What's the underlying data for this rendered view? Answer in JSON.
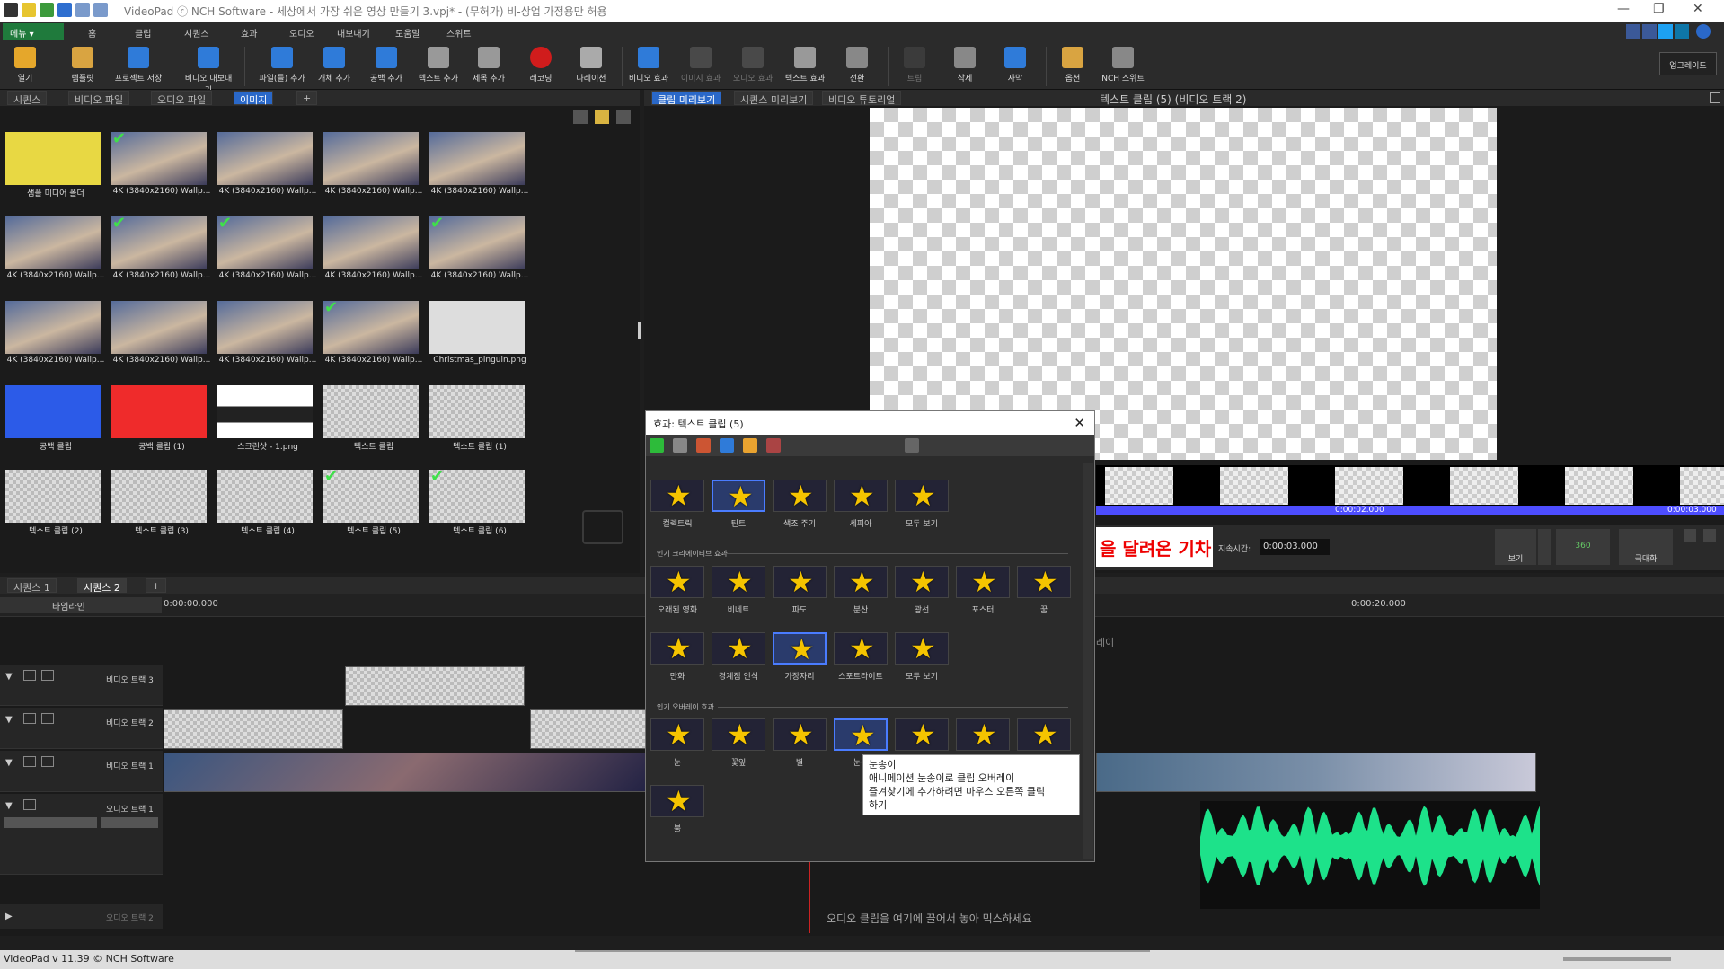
{
  "titlebar": {
    "title": "VideoPad ⓒ NCH Software - 세상에서 가장 쉬운 영상 만들기 3.vpj* - (무허가) 비-상업 가정용만 허용"
  },
  "menu": {
    "menu_button": "메뉴 ▾",
    "items": [
      "홈",
      "클립",
      "시퀀스",
      "효과",
      "오디오",
      "내보내기",
      "도움말",
      "스위트"
    ]
  },
  "toolbar": {
    "buttons": [
      "열기",
      "템플릿",
      "프로젝트 저장",
      "비디오 내보내기",
      "파일(들) 추가",
      "개체 추가",
      "공백 추가",
      "텍스트 추가",
      "제목 추가",
      "레코딩",
      "나레이션",
      "비디오 효과",
      "이미지 효과",
      "오디오 효과",
      "텍스트 효과",
      "전환",
      "트림",
      "삭제",
      "자막",
      "옵션",
      "NCH 스위트"
    ],
    "upgrade": "업그레이드"
  },
  "media_tabs": [
    "시퀀스",
    "비디오 파일",
    "오디오 파일",
    "이미지"
  ],
  "media_items": [
    {
      "label": "샘플 미디어 폴더",
      "check": false,
      "kind": "folder"
    },
    {
      "label": "4K (3840x2160) Wallp...",
      "check": true,
      "kind": "photo"
    },
    {
      "label": "4K (3840x2160) Wallp...",
      "check": false,
      "kind": "photo"
    },
    {
      "label": "4K (3840x2160) Wallp...",
      "check": false,
      "kind": "photo"
    },
    {
      "label": "4K (3840x2160) Wallp...",
      "check": false,
      "kind": "photo"
    },
    {
      "label": "4K (3840x2160) Wallp...",
      "check": false,
      "kind": "photo"
    },
    {
      "label": "4K (3840x2160) Wallp...",
      "check": true,
      "kind": "photo"
    },
    {
      "label": "4K (3840x2160) Wallp...",
      "check": true,
      "kind": "photo"
    },
    {
      "label": "4K (3840x2160) Wallp...",
      "check": false,
      "kind": "photo"
    },
    {
      "label": "4K (3840x2160) Wallp...",
      "check": true,
      "kind": "photo"
    },
    {
      "label": "4K (3840x2160) Wallp...",
      "check": false,
      "kind": "photo"
    },
    {
      "label": "4K (3840x2160) Wallp...",
      "check": false,
      "kind": "photo"
    },
    {
      "label": "4K (3840x2160) Wallp...",
      "check": false,
      "kind": "photo"
    },
    {
      "label": "4K (3840x2160) Wallp...",
      "check": true,
      "kind": "photo"
    },
    {
      "label": "Christmas_pinguin.png",
      "check": false,
      "kind": "penguin"
    },
    {
      "label": "공백 클립",
      "check": false,
      "kind": "blue"
    },
    {
      "label": "공백 클립 (1)",
      "check": false,
      "kind": "red"
    },
    {
      "label": "스크린샷 - 1.png",
      "check": false,
      "kind": "screenshot"
    },
    {
      "label": "텍스트 클립",
      "check": false,
      "kind": "checker"
    },
    {
      "label": "텍스트 클립 (1)",
      "check": false,
      "kind": "checker"
    },
    {
      "label": "텍스트 클립 (2)",
      "check": false,
      "kind": "checker"
    },
    {
      "label": "텍스트 클립 (3)",
      "check": false,
      "kind": "checker"
    },
    {
      "label": "텍스트 클립 (4)",
      "check": false,
      "kind": "checker"
    },
    {
      "label": "텍스트 클립 (5)",
      "check": true,
      "kind": "checker"
    },
    {
      "label": "텍스트 클립 (6)",
      "check": true,
      "kind": "checker"
    }
  ],
  "preview": {
    "tabs": [
      "클립 미리보기",
      "시퀀스 미리보기",
      "비디오 튜토리얼"
    ],
    "clip_title": "텍스트 클립 (5) (비디오 트랙 2)",
    "time_mid": "0:00:02.000",
    "time_end": "0:00:03.000",
    "red_title_text": "을 달려온 기차",
    "duration_label": "지속시간:",
    "duration_value": "0:00:03.000",
    "view_label": "보기",
    "fullscreen_label": "극대화",
    "vr_label": "360"
  },
  "sequence": {
    "tabs": [
      "시퀀스 1",
      "시퀀스 2"
    ],
    "timeline_dropdown": "타임라인",
    "ruler_start": "0:00:00.000",
    "ruler_mid": "0:00:20.000",
    "overlay_hint": "레이",
    "tracks": [
      "비디오 트랙 3",
      "비디오 트랙 2",
      "비디오 트랙 1",
      "오디오 트랙 1",
      "오디오 트랙 2"
    ],
    "audio_hint": "오디오 클립을 여기에 끌어서 놓아 믹스하세요"
  },
  "effects_dialog": {
    "title": "효과: 텍스트 클립 (5)",
    "top_effects": [
      "컬렉트릭",
      "틴트",
      "색조 주기",
      "세피아",
      "모두 보기"
    ],
    "creative_header": "인기 크리에이티브 효과",
    "creative_row1": [
      "오래된 영화",
      "비네트",
      "파도",
      "분산",
      "광선",
      "포스터",
      "꿈"
    ],
    "creative_row2": [
      "만화",
      "경계점 인식",
      "가장자리",
      "스포트라이트",
      "모두 보기"
    ],
    "overlay_header": "인기 오버레이 효과",
    "overlay_row": [
      "눈",
      "꽃잎",
      "별",
      "눈송",
      "",
      "",
      ""
    ],
    "overlay_extra": [
      "불"
    ],
    "tooltip": [
      "눈송이",
      "애니메이션 눈송이로 클립 오버레이",
      "즐겨찾기에 추가하려면 마우스 오른쪽 클릭",
      "하기"
    ]
  },
  "status": {
    "version": "VideoPad v 11.39 © NCH Software"
  }
}
